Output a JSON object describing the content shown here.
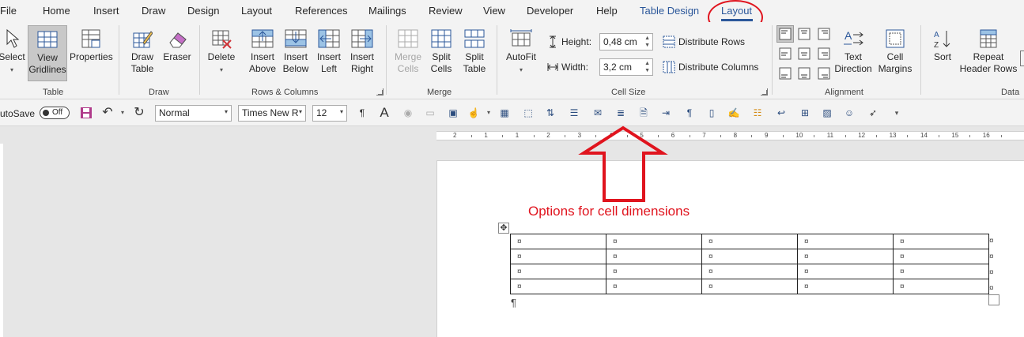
{
  "tabs": {
    "file": "File",
    "home": "Home",
    "insert": "Insert",
    "draw": "Draw",
    "design": "Design",
    "layout_page": "Layout",
    "references": "References",
    "mailings": "Mailings",
    "review": "Review",
    "view": "View",
    "developer": "Developer",
    "help": "Help",
    "table_design": "Table Design",
    "layout_table": "Layout"
  },
  "ribbon": {
    "table": {
      "select": "Select",
      "view_gridlines_1": "View",
      "view_gridlines_2": "Gridlines",
      "properties": "Properties",
      "group": "Table"
    },
    "draw": {
      "draw_table_1": "Draw",
      "draw_table_2": "Table",
      "eraser": "Eraser",
      "group": "Draw"
    },
    "rows_columns": {
      "delete": "Delete",
      "insert_above_1": "Insert",
      "insert_above_2": "Above",
      "insert_below_1": "Insert",
      "insert_below_2": "Below",
      "insert_left_1": "Insert",
      "insert_left_2": "Left",
      "insert_right_1": "Insert",
      "insert_right_2": "Right",
      "group": "Rows & Columns"
    },
    "merge": {
      "merge_cells_1": "Merge",
      "merge_cells_2": "Cells",
      "split_cells_1": "Split",
      "split_cells_2": "Cells",
      "split_table_1": "Split",
      "split_table_2": "Table",
      "group": "Merge"
    },
    "cell_size": {
      "autofit": "AutoFit",
      "height_label": "Height:",
      "height_value": "0,48 cm",
      "width_label": "Width:",
      "width_value": "3,2 cm",
      "distribute_rows": "Distribute Rows",
      "distribute_columns": "Distribute Columns",
      "group": "Cell Size"
    },
    "alignment": {
      "text_direction_1": "Text",
      "text_direction_2": "Direction",
      "cell_margins_1": "Cell",
      "cell_margins_2": "Margins",
      "group": "Alignment"
    },
    "data": {
      "sort": "Sort",
      "repeat_header_1": "Repeat",
      "repeat_header_2": "Header Rows",
      "group": "Data"
    }
  },
  "qat": {
    "autosave": "utoSave",
    "toggle": "Off",
    "style": "Normal",
    "font": "Times New R",
    "size": "12"
  },
  "ruler": [
    "2",
    "1",
    "1",
    "2",
    "3",
    "4",
    "5",
    "6",
    "7",
    "8",
    "9",
    "10",
    "11",
    "12",
    "13",
    "14",
    "15",
    "16"
  ],
  "annotation": "Options for cell dimensions",
  "document": {
    "cell_mark": "¤",
    "rows": 4,
    "cols": 5,
    "paragraph_mark": "¶"
  },
  "colors": {
    "accent": "#2b579a",
    "annotation_red": "#e0141e"
  }
}
